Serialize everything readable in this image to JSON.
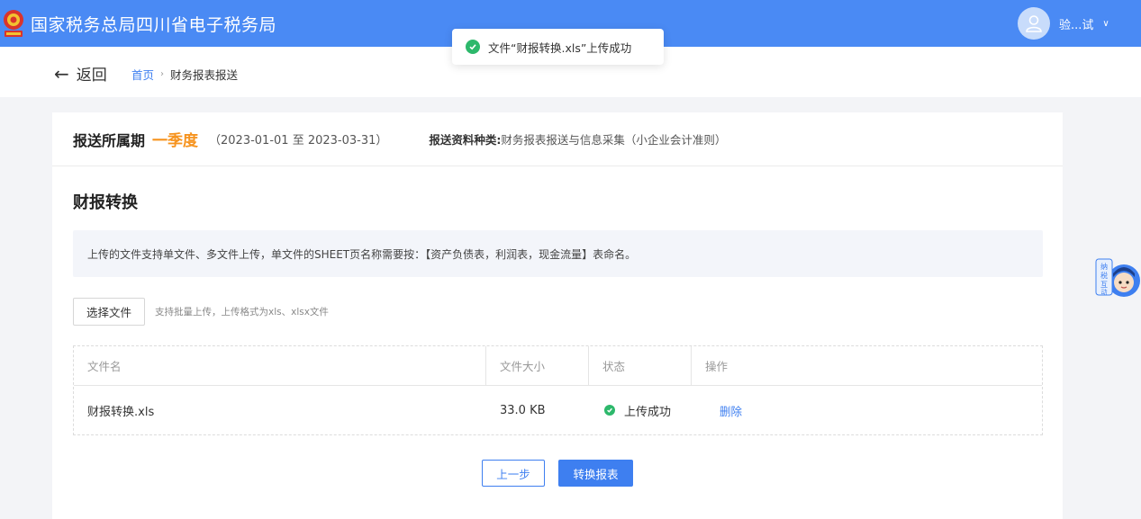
{
  "header": {
    "site_title": "国家税务总局四川省电子税务局",
    "username": "验...试",
    "colors": {
      "bar": "#4a8af4",
      "accent": "#3e7ff0",
      "success": "#2db86b",
      "highlight": "#f6931e"
    }
  },
  "toast": {
    "message": "文件“财报转换.xls”上传成功",
    "icon": "check-circle-icon"
  },
  "nav": {
    "back_label": "返回",
    "breadcrumb_home": "首页",
    "breadcrumb_separator": "›",
    "breadcrumb_current": "财务报表报送"
  },
  "period": {
    "label": "报送所属期",
    "value": "一季度",
    "range": "（2023-01-01 至 2023-03-31）",
    "type_label": "报送资料种类:",
    "type_value": "财务报表报送与信息采集（小企业会计准则）"
  },
  "section": {
    "title": "财报转换",
    "notice": "上传的文件支持单文件、多文件上传，单文件的SHEET页名称需要按：【资产负债表，利润表，现金流量】表命名。"
  },
  "upload": {
    "choose_label": "选择文件",
    "hint": "支持批量上传，上传格式为xls、xlsx文件"
  },
  "table": {
    "headers": [
      "文件名",
      "文件大小",
      "状态",
      "操作"
    ],
    "rows": [
      {
        "name": "财报转换.xls",
        "size": "33.0 KB",
        "status": "上传成功",
        "action": "删除"
      }
    ]
  },
  "actions": {
    "prev_label": "上一步",
    "convert_label": "转换报表"
  },
  "mascot": {
    "icon": "mascot-assistant-icon",
    "text": "纳税互动"
  }
}
